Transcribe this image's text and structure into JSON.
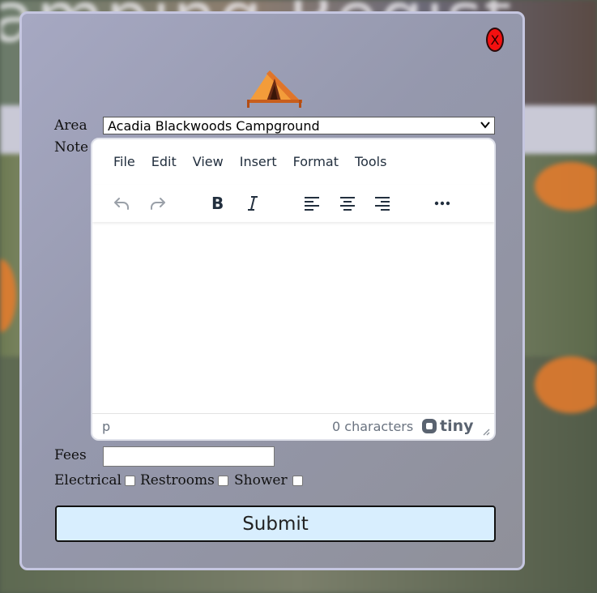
{
  "background": {
    "heading_fragment": "amping Regist"
  },
  "modal": {
    "close_label": "X"
  },
  "form": {
    "area_label": "Area",
    "area_selected": "Acadia Blackwoods Campground",
    "note_label": "Note",
    "fees_label": "Fees",
    "fees_value": "",
    "amenities": [
      {
        "label": "Electrical",
        "checked": false
      },
      {
        "label": "Restrooms",
        "checked": false
      },
      {
        "label": "Shower",
        "checked": false
      }
    ],
    "submit_label": "Submit"
  },
  "editor": {
    "menu": [
      "File",
      "Edit",
      "View",
      "Insert",
      "Format",
      "Tools"
    ],
    "toolbar_icons": [
      "undo-icon",
      "redo-icon",
      "bold-icon",
      "italic-icon",
      "align-left-icon",
      "align-center-icon",
      "align-right-icon",
      "more-icon"
    ],
    "status_path": "p",
    "char_count": "0 characters",
    "brand": "tiny"
  },
  "colors": {
    "close_button": "#f31010",
    "submit_bg": "#d8eefe",
    "tent": "#f39c3a",
    "editor_text": "#222f3e"
  }
}
